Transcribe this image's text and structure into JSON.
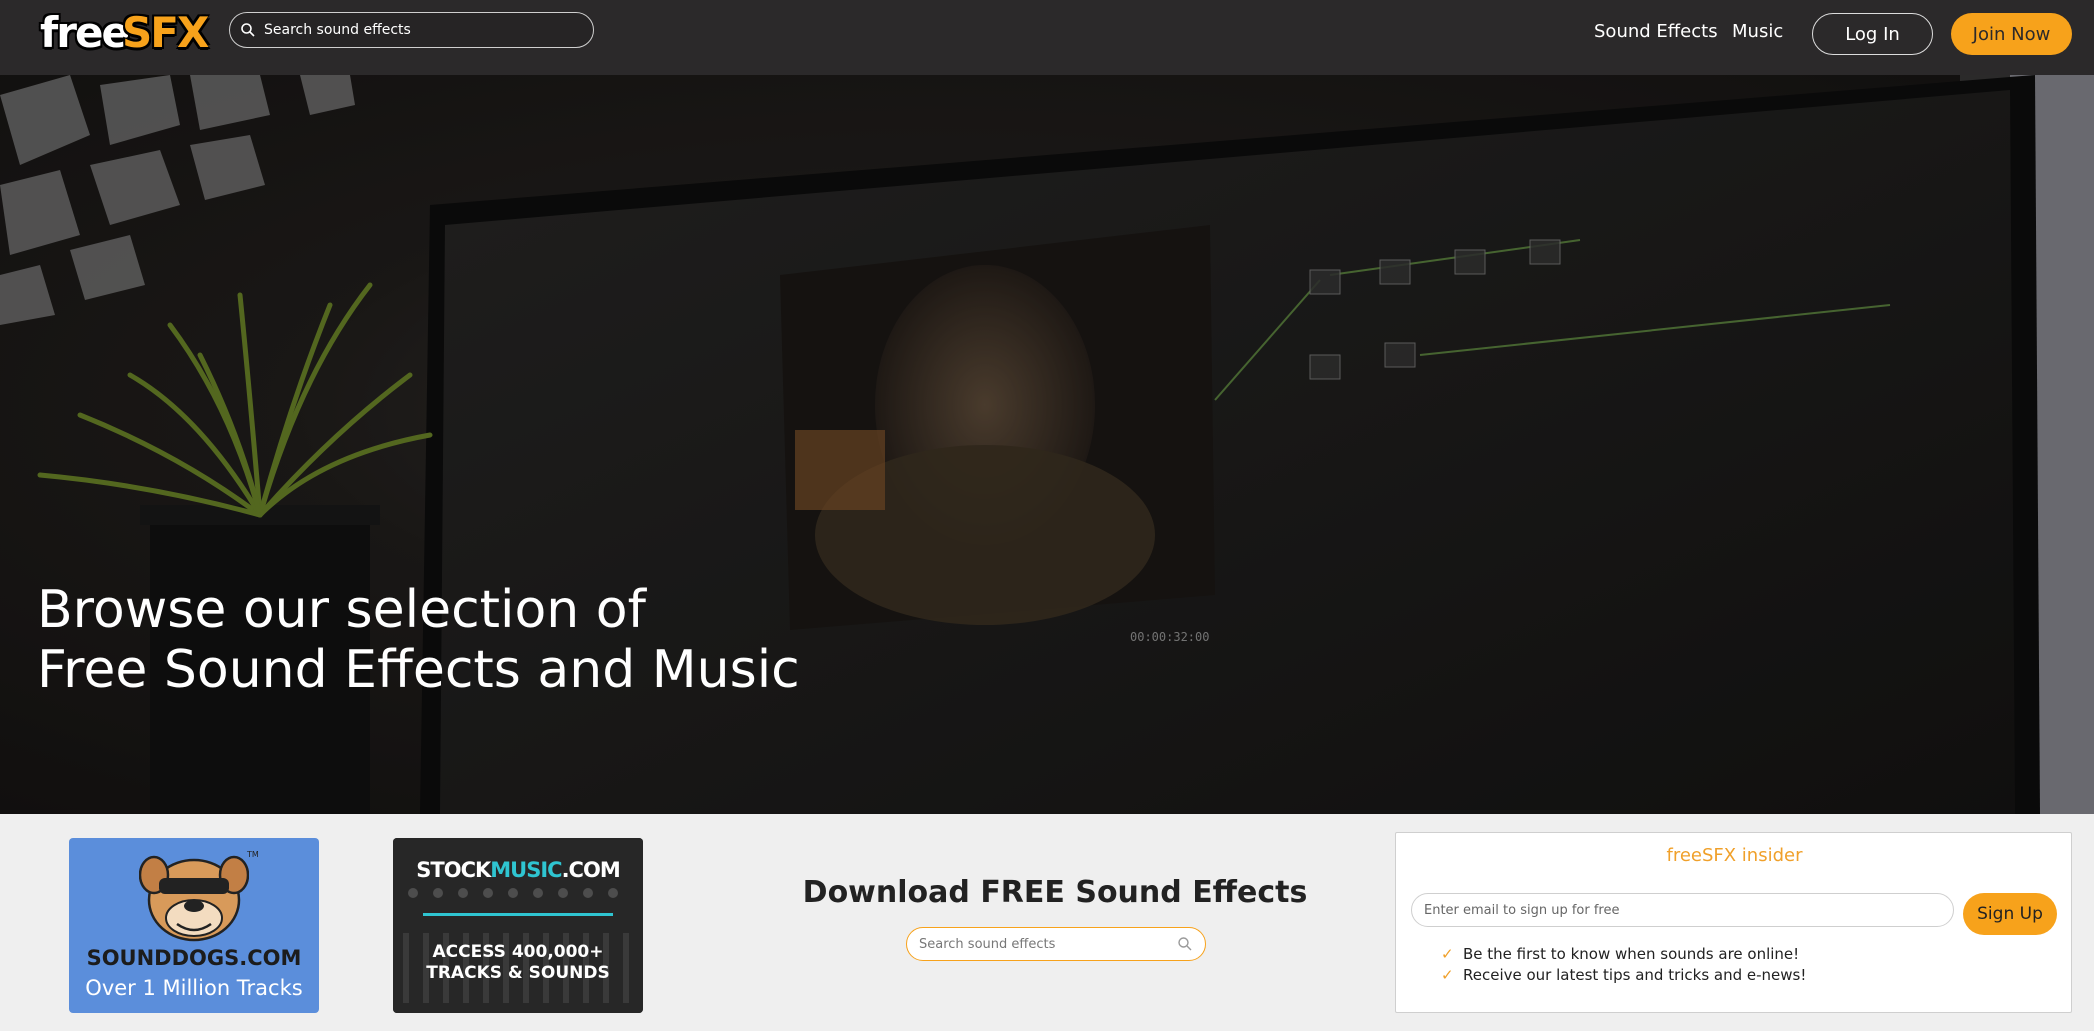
{
  "header": {
    "logo": {
      "part1": "free",
      "part2": "SFX"
    },
    "search": {
      "placeholder": "Search sound effects",
      "icon": "search-icon"
    },
    "nav": {
      "sound_effects": "Sound Effects",
      "music": "Music"
    },
    "login_label": "Log In",
    "join_label": "Join Now"
  },
  "hero": {
    "title_line1": "Browse our selection of",
    "title_line2": "Free Sound Effects and Music"
  },
  "ads": {
    "sounddogs": {
      "brand": "SOUNDDOGS.COM",
      "tagline": "Over 1 Million Tracks",
      "tm": "TM"
    },
    "stockmusic": {
      "brand_part1": "STOCK",
      "brand_part2": "MUSIC",
      "brand_part3": ".COM",
      "line1": "ACCESS 400,000+",
      "line2": "TRACKS & SOUNDS"
    }
  },
  "download": {
    "title": "Download FREE Sound Effects",
    "search_placeholder": "Search sound effects"
  },
  "insider": {
    "title": "freeSFX insider",
    "email_placeholder": "Enter email to sign up for free",
    "signup_label": "Sign Up",
    "perks": [
      "Be the first to know when sounds are online!",
      "Receive our latest tips and tricks and e-news!"
    ]
  },
  "colors": {
    "accent": "#f7a21b",
    "header_bg": "#2b292a",
    "teal": "#2fc5d1",
    "sounddogs_bg": "#5b8edb"
  }
}
